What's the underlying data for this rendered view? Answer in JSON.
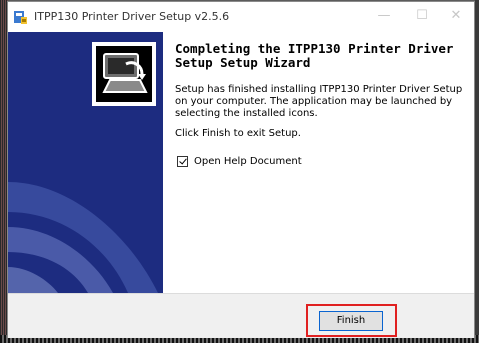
{
  "window": {
    "title": "ITPP130 Printer Driver Setup v2.5.6",
    "controls": {
      "minimize": "—",
      "maximize": "☐",
      "close": "✕"
    },
    "icon": "setup-app-icon"
  },
  "wizard": {
    "heading": "Completing the ITPP130 Printer Driver Setup Setup Wizard",
    "body": "Setup has finished installing ITPP130 Printer Driver Setup on your computer. The application may be launched by selecting the installed icons.",
    "finish_instruction": "Click Finish to exit Setup.",
    "checkbox_label": "Open Help Document",
    "checkbox_checked": true,
    "logo_icon": "computer-setup-icon"
  },
  "footer": {
    "finish_label": "Finish"
  },
  "colors": {
    "sidebar": "#1d2c80",
    "highlight": "#e02020",
    "button_border": "#0a64d0"
  }
}
